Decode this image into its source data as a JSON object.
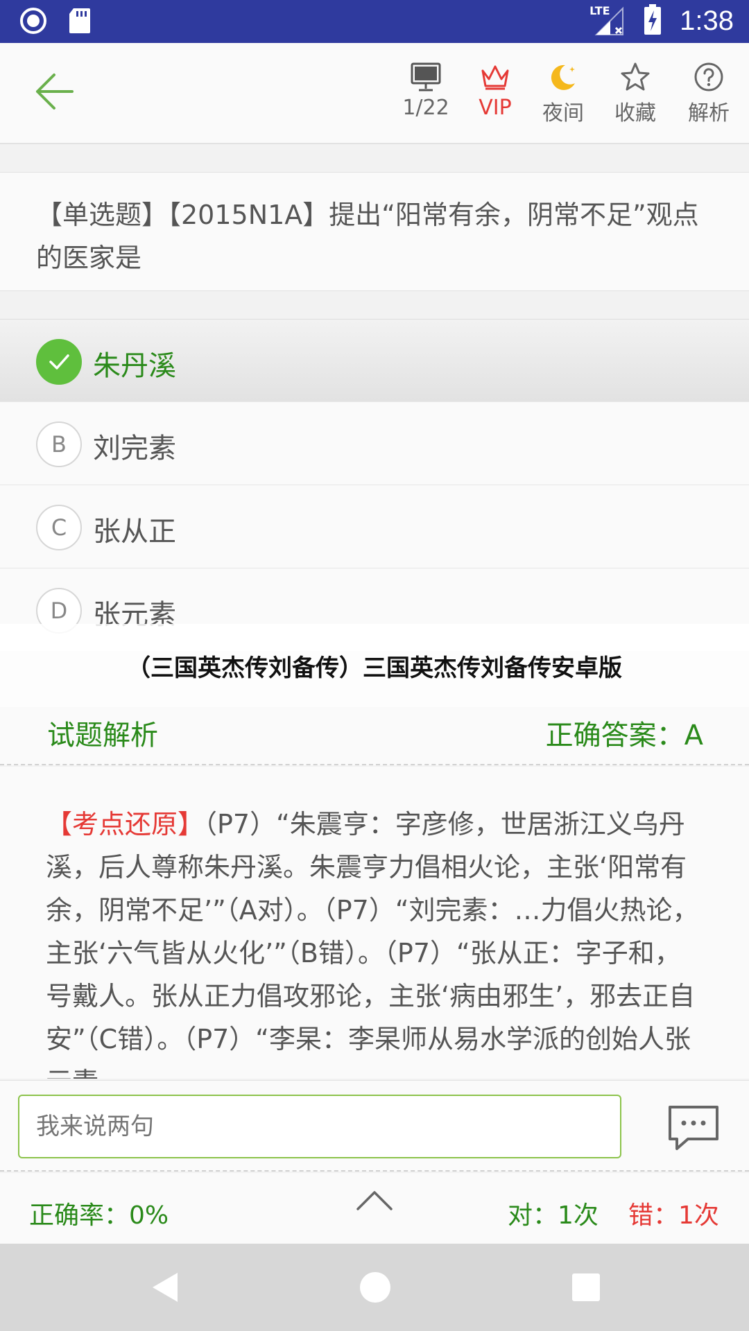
{
  "status": {
    "time": "1:38",
    "network": "LTE"
  },
  "toolbar": {
    "counter": "1/22",
    "vip": "VIP",
    "night": "夜间",
    "favorite": "收藏",
    "analysis": "解析"
  },
  "question": {
    "text": "【单选题】【2015N1A】提出“阳常有余，阴常不足”观点的医家是"
  },
  "options": [
    {
      "letter": "A",
      "text": "朱丹溪",
      "selected": true
    },
    {
      "letter": "B",
      "text": "刘完素"
    },
    {
      "letter": "C",
      "text": "张从正"
    },
    {
      "letter": "D",
      "text": "张元素"
    }
  ],
  "banner": "（三国英杰传刘备传）三国英杰传刘备传安卓版",
  "analysis": {
    "title": "试题解析",
    "answer": "正确答案：A",
    "tag": "【考点还原】",
    "body": "（P7）“朱震亨：字彦修，世居浙江义乌丹溪，后人尊称朱丹溪。朱震亨力倡相火论，主张‘阳常有余，阴常不足’”（A对）。（P7）“刘完素：…力倡火热论，主张‘六气皆从火化’”（B错）。（P7）“张从正：字子和，号戴人。张从正力倡攻邪论，主张‘病由邪生’，邪去正自安”（C错）。（P7）“李杲：李杲师从易水学派的创始人张元素"
  },
  "comment": {
    "placeholder": "我来说两句"
  },
  "stats": {
    "accuracy": "正确率：0%",
    "right": "对：1次",
    "wrong": "错：1次"
  },
  "colors": {
    "status_bar": "#2f3a9e",
    "green": "#2a8a1a",
    "red": "#e53935",
    "check": "#5fbf3d"
  }
}
